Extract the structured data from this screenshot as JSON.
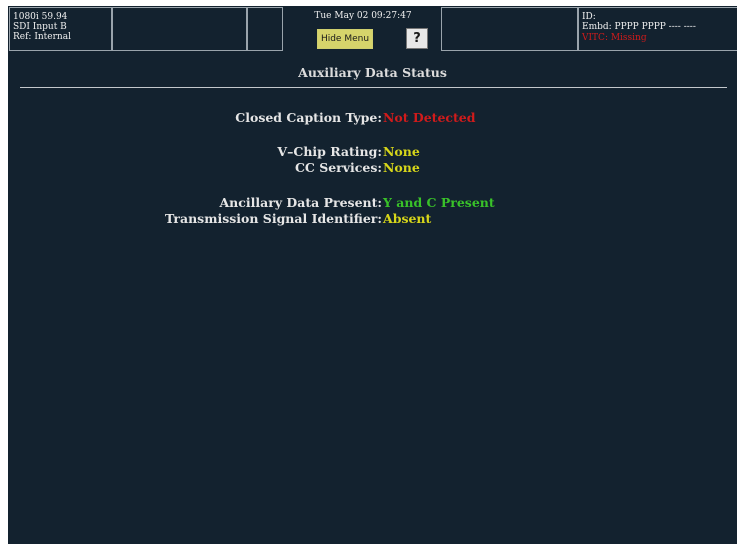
{
  "header": {
    "format": "1080i 59.94",
    "input": "SDI Input B",
    "ref": "Ref: Internal",
    "datetime": "Tue May 02 09:27:47",
    "hide_menu_label": "Hide Menu",
    "help_label": "?",
    "id_label": "ID:",
    "embd": "Embd: PPPP PPPP ---- ----",
    "vitc": "VITC: Missing"
  },
  "main": {
    "title": "Auxiliary Data Status",
    "rows": [
      {
        "label": "Closed Caption Type:",
        "value": "Not Detected",
        "color": "#d11b1b"
      },
      {
        "label": "V–Chip Rating:",
        "value": "None",
        "color": "#d7d61a"
      },
      {
        "label": "CC Services:",
        "value": "None",
        "color": "#d7d61a"
      },
      {
        "label": "Ancillary Data Present:",
        "value": "Y and C Present",
        "color": "#39c229"
      },
      {
        "label": "Transmission Signal Identifier:",
        "value": "Absent",
        "color": "#d7d61a"
      }
    ]
  },
  "colors": {
    "background": "#13222f",
    "error": "#d11b1b",
    "warning": "#d7d61a",
    "ok": "#39c229"
  }
}
